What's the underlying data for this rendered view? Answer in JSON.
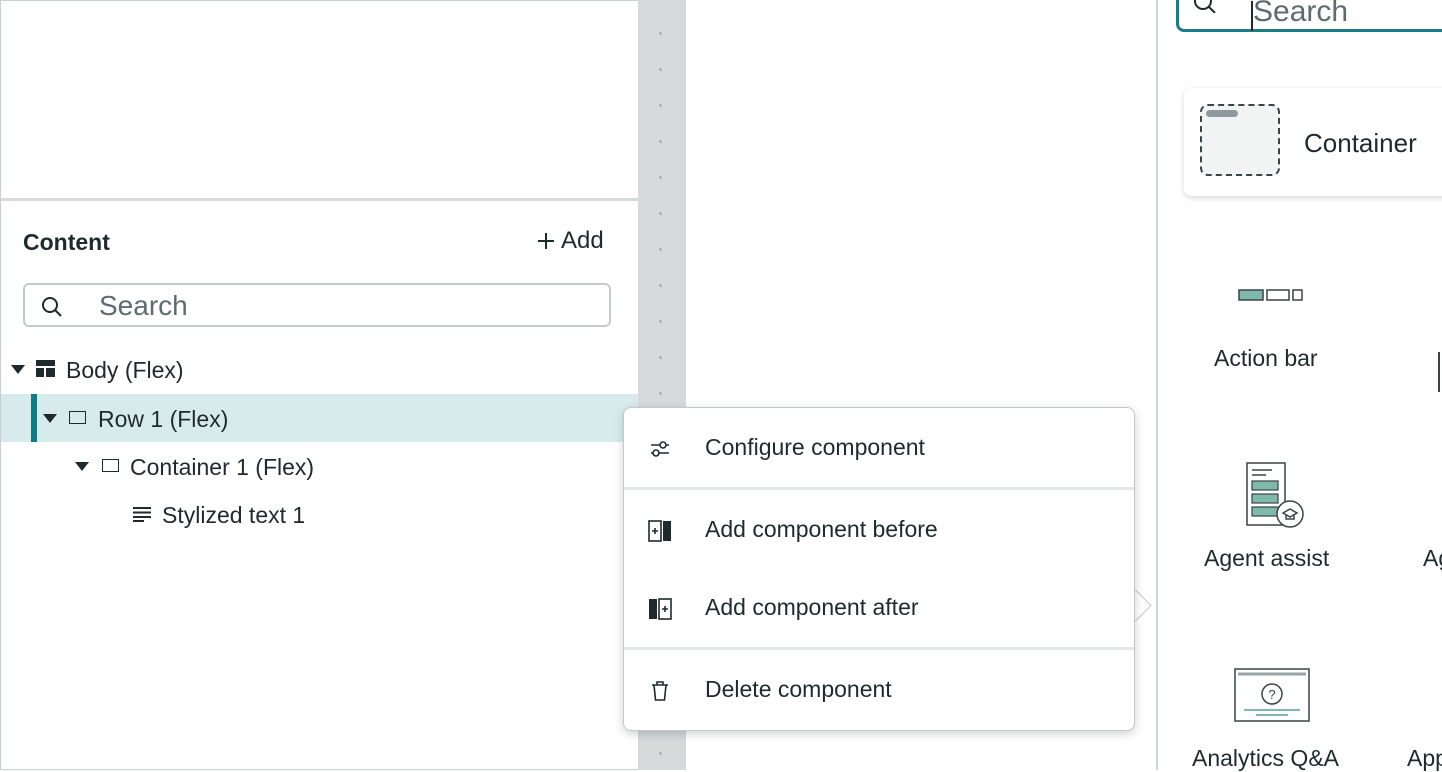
{
  "content_panel": {
    "title": "Content",
    "add_label": "Add",
    "search_placeholder": "Search"
  },
  "tree": {
    "body": "Body (Flex)",
    "row1": "Row 1 (Flex)",
    "container1": "Container 1 (Flex)",
    "stylized_text": "Stylized text 1"
  },
  "context_menu": {
    "configure": "Configure component",
    "add_before": "Add component before",
    "add_after": "Add component after",
    "delete": "Delete component"
  },
  "component_panel": {
    "search_placeholder": "Search",
    "container": "Container",
    "action_bar": "Action bar",
    "agent_assist": "Agent assist",
    "analytics_qa": "Analytics Q&A",
    "partial_agent": "Ag",
    "partial_app": "App"
  },
  "colors": {
    "accent": "#0f7c85",
    "selected_row": "#d8ebec",
    "gutter": "#d6dadb",
    "component_icon_fill": "#7fb9ac"
  }
}
